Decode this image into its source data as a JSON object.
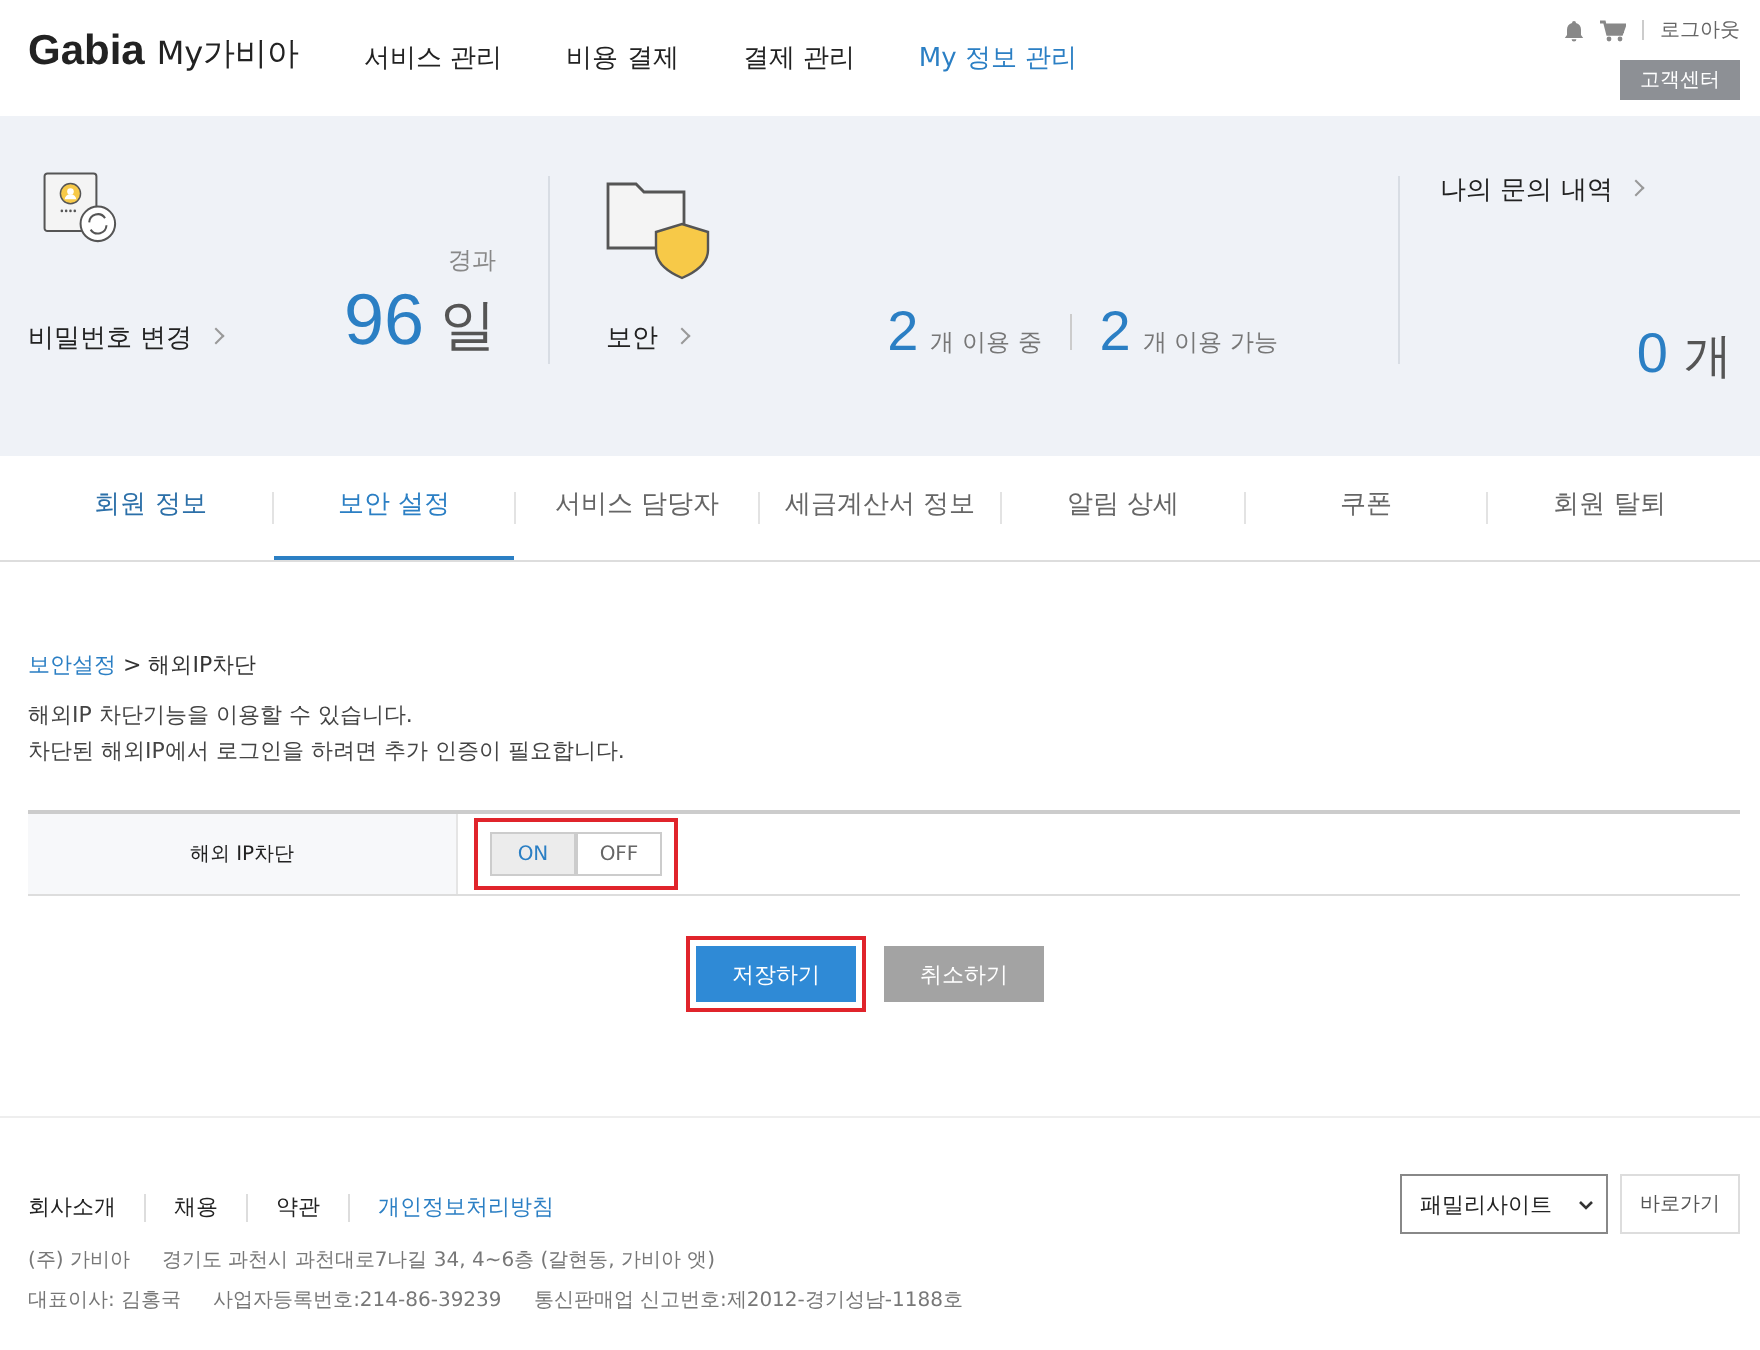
{
  "header": {
    "logo": "Gabia",
    "logo_sub": "My가비아",
    "nav": [
      {
        "label": "서비스 관리",
        "selected": false
      },
      {
        "label": "비용 결제",
        "selected": false
      },
      {
        "label": "결제 관리",
        "selected": false
      },
      {
        "label": "My 정보 관리",
        "selected": true
      }
    ],
    "logout": "로그아웃",
    "support": "고객센터"
  },
  "summary": {
    "password": {
      "label": "비밀번호 변경",
      "caption": "경과",
      "value": "96",
      "unit": "일"
    },
    "security": {
      "label": "보안",
      "stats": [
        {
          "value": "2",
          "unit": "개 이용 중"
        },
        {
          "value": "2",
          "unit": "개 이용 가능"
        }
      ]
    },
    "inquiry": {
      "label": "나의 문의 내역",
      "value": "0",
      "unit": "개"
    }
  },
  "tabs": [
    {
      "label": "회원 정보",
      "selected": false
    },
    {
      "label": "보안 설정",
      "selected": true
    },
    {
      "label": "서비스 담당자",
      "selected": false
    },
    {
      "label": "세금계산서 정보",
      "selected": false
    },
    {
      "label": "알림 상세",
      "selected": false
    },
    {
      "label": "쿠폰",
      "selected": false
    },
    {
      "label": "회원 탈퇴",
      "selected": false
    }
  ],
  "breadcrumb": {
    "link": "보안설정",
    "separator": ">",
    "current": "해외IP차단"
  },
  "description": [
    "해외IP 차단기능을 이용할 수 있습니다.",
    "차단된 해외IP에서 로그인을 하려면 추가 인증이 필요합니다."
  ],
  "setting": {
    "label": "해외 IP차단",
    "highlighted": true,
    "options": [
      {
        "label": "ON",
        "selected": true
      },
      {
        "label": "OFF",
        "selected": false
      }
    ]
  },
  "buttons": [
    {
      "label": "저장하기",
      "kind": "primary",
      "highlighted": true
    },
    {
      "label": "취소하기",
      "kind": "secondary",
      "highlighted": false
    }
  ],
  "footer": {
    "links": [
      {
        "label": "회사소개",
        "kind": "plain"
      },
      {
        "label": "채용",
        "kind": "plain"
      },
      {
        "label": "약관",
        "kind": "plain"
      },
      {
        "label": "개인정보처리방침",
        "kind": "accent"
      }
    ],
    "family_select": "패밀리사이트",
    "go_button": "바로가기",
    "info": [
      [
        "(주) 가비아",
        "경기도 과천시 과천대로7나길 34, 4~6층 (갈현동, 가비아 앳)"
      ],
      [
        "대표이사: 김홍국",
        "사업자등록번호:214-86-39239",
        "통신판매업 신고번호:제2012-경기성남-1188호"
      ]
    ]
  }
}
